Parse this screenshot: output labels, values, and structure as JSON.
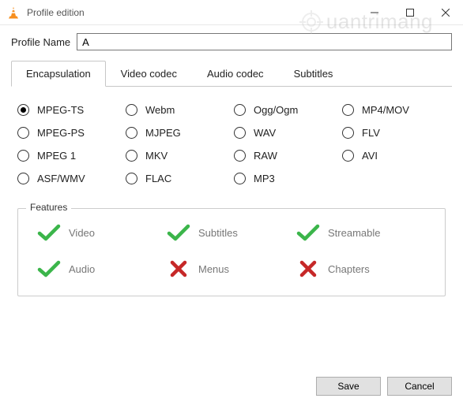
{
  "window": {
    "title": "Profile edition"
  },
  "profile": {
    "label": "Profile Name",
    "value": "A"
  },
  "tabs": [
    {
      "label": "Encapsulation",
      "active": true
    },
    {
      "label": "Video codec",
      "active": false
    },
    {
      "label": "Audio codec",
      "active": false
    },
    {
      "label": "Subtitles",
      "active": false
    }
  ],
  "formats": [
    {
      "label": "MPEG-TS",
      "selected": true
    },
    {
      "label": "Webm",
      "selected": false
    },
    {
      "label": "Ogg/Ogm",
      "selected": false
    },
    {
      "label": "MP4/MOV",
      "selected": false
    },
    {
      "label": "MPEG-PS",
      "selected": false
    },
    {
      "label": "MJPEG",
      "selected": false
    },
    {
      "label": "WAV",
      "selected": false
    },
    {
      "label": "FLV",
      "selected": false
    },
    {
      "label": "MPEG 1",
      "selected": false
    },
    {
      "label": "MKV",
      "selected": false
    },
    {
      "label": "RAW",
      "selected": false
    },
    {
      "label": "AVI",
      "selected": false
    },
    {
      "label": "ASF/WMV",
      "selected": false
    },
    {
      "label": "FLAC",
      "selected": false
    },
    {
      "label": "MP3",
      "selected": false
    }
  ],
  "features": {
    "legend": "Features",
    "items": [
      {
        "label": "Video",
        "ok": true
      },
      {
        "label": "Subtitles",
        "ok": true
      },
      {
        "label": "Streamable",
        "ok": true
      },
      {
        "label": "Audio",
        "ok": true
      },
      {
        "label": "Menus",
        "ok": false
      },
      {
        "label": "Chapters",
        "ok": false
      }
    ]
  },
  "buttons": {
    "save": "Save",
    "cancel": "Cancel"
  },
  "watermark": "uantrimang"
}
